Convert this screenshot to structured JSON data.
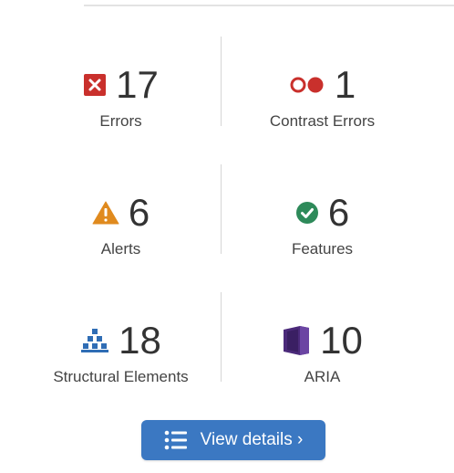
{
  "summary": {
    "items": [
      {
        "key": "errors",
        "count": "17",
        "label": "Errors",
        "icon": "error-icon",
        "color": "#c9302c"
      },
      {
        "key": "contrast",
        "count": "1",
        "label": "Contrast Errors",
        "icon": "contrast-icon",
        "color": "#c9302c"
      },
      {
        "key": "alerts",
        "count": "6",
        "label": "Alerts",
        "icon": "alert-icon",
        "color": "#e08a1e"
      },
      {
        "key": "features",
        "count": "6",
        "label": "Features",
        "icon": "feature-icon",
        "color": "#2e8a5a"
      },
      {
        "key": "structure",
        "count": "18",
        "label": "Structural Elements",
        "icon": "structure-icon",
        "color": "#2f6db5"
      },
      {
        "key": "aria",
        "count": "10",
        "label": "ARIA",
        "icon": "aria-icon",
        "color": "#4b2a7a"
      }
    ]
  },
  "actions": {
    "view_details_label": "View details ›",
    "button_color": "#3b78c2"
  }
}
